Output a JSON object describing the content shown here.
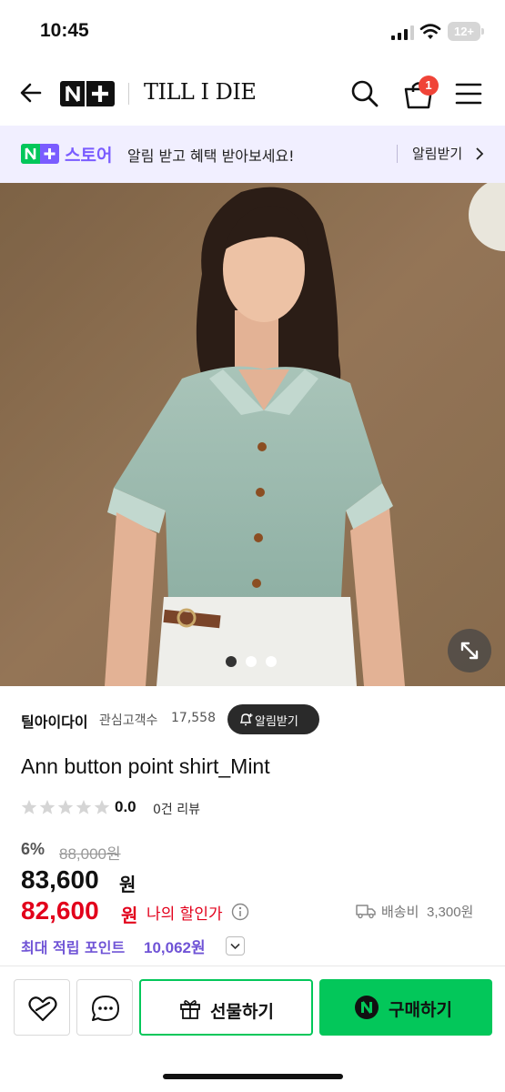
{
  "status_bar": {
    "time": "10:45",
    "battery": "12+"
  },
  "header": {
    "brand": "TILL I DIE",
    "cart_count": "1",
    "np_logo_icon": "naver-plus-logo"
  },
  "banner": {
    "store": "스토어",
    "message": "알림 받고 혜택 받아보세요!",
    "action": "알림받기"
  },
  "gallery": {
    "image_count": 3,
    "active_index": 0,
    "image_icon": "model-photo"
  },
  "product": {
    "store_name": "틸아이다이",
    "fav_label": "관심고객수",
    "fav_count": "17,558",
    "alarm_label": "알림받기",
    "title": "Ann button point shirt_Mint",
    "rating": "0.0",
    "rating_fraction": 0,
    "reviews": "0건 리뷰",
    "discount_rate": "6%",
    "original_price": "88,000원",
    "price": "83,600",
    "price_unit": "원",
    "my_price": "82,600",
    "my_price_unit": "원",
    "my_price_label": "나의 할인가",
    "shipping_label": "배송비",
    "shipping_fee": "3,300원",
    "points_label": "최대 적립 포인트",
    "points_value": "10,062원"
  },
  "actions": {
    "gift": "선물하기",
    "buy": "구매하기"
  },
  "colors": {
    "naver_green": "#03c75a",
    "plus_purple": "#7a5cff",
    "sale_red": "#e2001b",
    "points_purple": "#7054d6",
    "badge_red": "#f04438"
  }
}
